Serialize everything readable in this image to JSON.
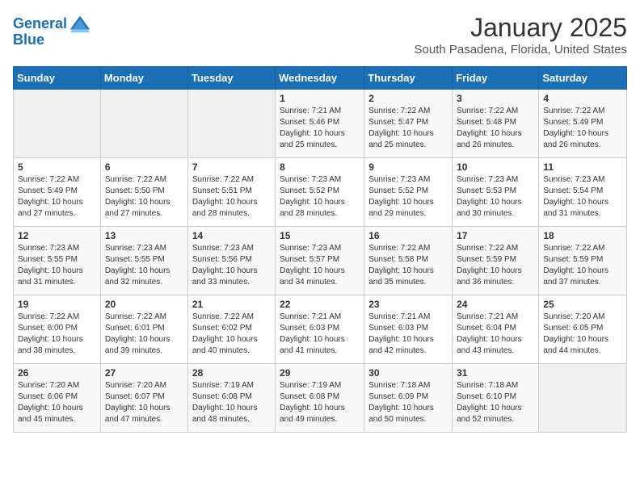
{
  "logo": {
    "line1": "General",
    "line2": "Blue"
  },
  "title": "January 2025",
  "subtitle": "South Pasadena, Florida, United States",
  "days_of_week": [
    "Sunday",
    "Monday",
    "Tuesday",
    "Wednesday",
    "Thursday",
    "Friday",
    "Saturday"
  ],
  "weeks": [
    [
      {
        "day": "",
        "info": ""
      },
      {
        "day": "",
        "info": ""
      },
      {
        "day": "",
        "info": ""
      },
      {
        "day": "1",
        "info": "Sunrise: 7:21 AM\nSunset: 5:46 PM\nDaylight: 10 hours\nand 25 minutes."
      },
      {
        "day": "2",
        "info": "Sunrise: 7:22 AM\nSunset: 5:47 PM\nDaylight: 10 hours\nand 25 minutes."
      },
      {
        "day": "3",
        "info": "Sunrise: 7:22 AM\nSunset: 5:48 PM\nDaylight: 10 hours\nand 26 minutes."
      },
      {
        "day": "4",
        "info": "Sunrise: 7:22 AM\nSunset: 5:49 PM\nDaylight: 10 hours\nand 26 minutes."
      }
    ],
    [
      {
        "day": "5",
        "info": "Sunrise: 7:22 AM\nSunset: 5:49 PM\nDaylight: 10 hours\nand 27 minutes."
      },
      {
        "day": "6",
        "info": "Sunrise: 7:22 AM\nSunset: 5:50 PM\nDaylight: 10 hours\nand 27 minutes."
      },
      {
        "day": "7",
        "info": "Sunrise: 7:22 AM\nSunset: 5:51 PM\nDaylight: 10 hours\nand 28 minutes."
      },
      {
        "day": "8",
        "info": "Sunrise: 7:23 AM\nSunset: 5:52 PM\nDaylight: 10 hours\nand 28 minutes."
      },
      {
        "day": "9",
        "info": "Sunrise: 7:23 AM\nSunset: 5:52 PM\nDaylight: 10 hours\nand 29 minutes."
      },
      {
        "day": "10",
        "info": "Sunrise: 7:23 AM\nSunset: 5:53 PM\nDaylight: 10 hours\nand 30 minutes."
      },
      {
        "day": "11",
        "info": "Sunrise: 7:23 AM\nSunset: 5:54 PM\nDaylight: 10 hours\nand 31 minutes."
      }
    ],
    [
      {
        "day": "12",
        "info": "Sunrise: 7:23 AM\nSunset: 5:55 PM\nDaylight: 10 hours\nand 31 minutes."
      },
      {
        "day": "13",
        "info": "Sunrise: 7:23 AM\nSunset: 5:55 PM\nDaylight: 10 hours\nand 32 minutes."
      },
      {
        "day": "14",
        "info": "Sunrise: 7:23 AM\nSunset: 5:56 PM\nDaylight: 10 hours\nand 33 minutes."
      },
      {
        "day": "15",
        "info": "Sunrise: 7:23 AM\nSunset: 5:57 PM\nDaylight: 10 hours\nand 34 minutes."
      },
      {
        "day": "16",
        "info": "Sunrise: 7:22 AM\nSunset: 5:58 PM\nDaylight: 10 hours\nand 35 minutes."
      },
      {
        "day": "17",
        "info": "Sunrise: 7:22 AM\nSunset: 5:59 PM\nDaylight: 10 hours\nand 36 minutes."
      },
      {
        "day": "18",
        "info": "Sunrise: 7:22 AM\nSunset: 5:59 PM\nDaylight: 10 hours\nand 37 minutes."
      }
    ],
    [
      {
        "day": "19",
        "info": "Sunrise: 7:22 AM\nSunset: 6:00 PM\nDaylight: 10 hours\nand 38 minutes."
      },
      {
        "day": "20",
        "info": "Sunrise: 7:22 AM\nSunset: 6:01 PM\nDaylight: 10 hours\nand 39 minutes."
      },
      {
        "day": "21",
        "info": "Sunrise: 7:22 AM\nSunset: 6:02 PM\nDaylight: 10 hours\nand 40 minutes."
      },
      {
        "day": "22",
        "info": "Sunrise: 7:21 AM\nSunset: 6:03 PM\nDaylight: 10 hours\nand 41 minutes."
      },
      {
        "day": "23",
        "info": "Sunrise: 7:21 AM\nSunset: 6:03 PM\nDaylight: 10 hours\nand 42 minutes."
      },
      {
        "day": "24",
        "info": "Sunrise: 7:21 AM\nSunset: 6:04 PM\nDaylight: 10 hours\nand 43 minutes."
      },
      {
        "day": "25",
        "info": "Sunrise: 7:20 AM\nSunset: 6:05 PM\nDaylight: 10 hours\nand 44 minutes."
      }
    ],
    [
      {
        "day": "26",
        "info": "Sunrise: 7:20 AM\nSunset: 6:06 PM\nDaylight: 10 hours\nand 45 minutes."
      },
      {
        "day": "27",
        "info": "Sunrise: 7:20 AM\nSunset: 6:07 PM\nDaylight: 10 hours\nand 47 minutes."
      },
      {
        "day": "28",
        "info": "Sunrise: 7:19 AM\nSunset: 6:08 PM\nDaylight: 10 hours\nand 48 minutes."
      },
      {
        "day": "29",
        "info": "Sunrise: 7:19 AM\nSunset: 6:08 PM\nDaylight: 10 hours\nand 49 minutes."
      },
      {
        "day": "30",
        "info": "Sunrise: 7:18 AM\nSunset: 6:09 PM\nDaylight: 10 hours\nand 50 minutes."
      },
      {
        "day": "31",
        "info": "Sunrise: 7:18 AM\nSunset: 6:10 PM\nDaylight: 10 hours\nand 52 minutes."
      },
      {
        "day": "",
        "info": ""
      }
    ]
  ]
}
